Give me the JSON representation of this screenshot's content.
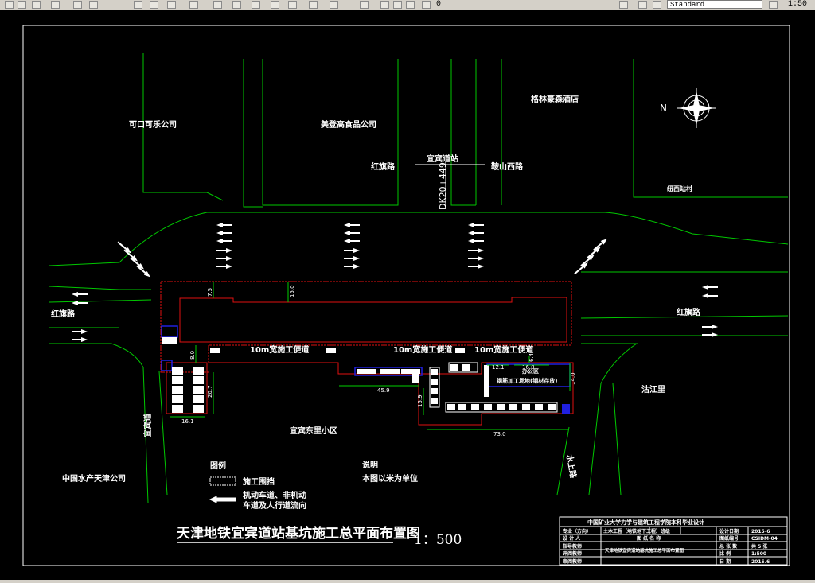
{
  "toolbar": {
    "text_style": "Standard",
    "layer_value": "0",
    "scale_value": "1:50"
  },
  "drawing": {
    "companies": {
      "coca_cola": "可口可乐公司",
      "food_co": "美登高食品公司",
      "hotel": "格林豪森酒店",
      "village": "纽西站村",
      "residential": "宜宾东里小区",
      "hongkong_garden": "沽江里",
      "china_water": "中国水产天津公司"
    },
    "roads": {
      "hongqi_top": "红旗路",
      "yibin_top": "宜宾道站",
      "anshan": "鞍山西路",
      "hongqi_left": "红旗路",
      "hongqi_right": "红旗路",
      "yibin_road": "宜宾道",
      "shuishang": "水上路"
    },
    "station_label": "DK20+449",
    "site": {
      "temp_road_1": "10m宽施工便道",
      "temp_road_2": "10m宽施工便道",
      "temp_road_3": "10m宽施工便道",
      "processing_area": "钢筋加工场地(钢材存放)",
      "office": "办公区"
    },
    "dims": {
      "d1": "7.5",
      "d2": "15.0",
      "d3": "8.0",
      "d4": "16.1",
      "d5": "20.7",
      "d6": "45.9",
      "d7": "15.9",
      "d8": "73.0",
      "d9": "6.4",
      "d10": "12.1",
      "d11": "16.0",
      "d12": "14.0"
    },
    "north": "N",
    "legend": {
      "title": "图例",
      "item1": "施工围挡",
      "item2_line1": "机动车道、非机动",
      "item2_line2": "车道及人行道流向"
    },
    "notes": {
      "title": "说明",
      "line1": "本图以米为单位"
    },
    "title": "天津地铁宜宾道站基坑施工总平面布置图",
    "scale": "1：500",
    "title_block": {
      "header": "中国矿业大学力学与建筑工程学院本科毕业设计",
      "r1c1": "专业（方向）",
      "r1c2": "土木工程（地铁地下工程）",
      "r1c3": "班级",
      "r1c4": "",
      "r1c5": "设计日期",
      "r1c6": "2015-6",
      "r2c1": "设 计 人",
      "r2c2": "图 纸 名 称",
      "r2c3": "图纸编号",
      "r2c4": "CSIDM-04",
      "r3c1": "指导教师",
      "r3c2": "天津地铁宜宾道站基坑施工总平面布置图",
      "r3c3": "总 张 数",
      "r3c4": "共 5 张",
      "r4c1": "评阅教师",
      "r4c3": "比 例",
      "r4c4": "1:500",
      "r5c1": "审阅教师",
      "r5c3": "日 期",
      "r5c4": "2015.6"
    }
  },
  "colors": {
    "background": "#000000",
    "road_green": "#00c800",
    "fence_red": "#e01010",
    "text_white": "#ffffff",
    "site_blue": "#2020e0",
    "dim_green": "#00d000"
  }
}
